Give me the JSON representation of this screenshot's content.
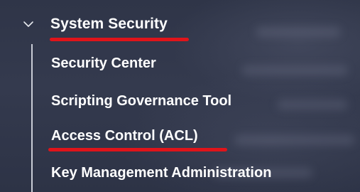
{
  "nav": {
    "group": {
      "label": "System Security",
      "icon": "chevron-down-icon",
      "expanded": true
    },
    "items": [
      {
        "label": "Security Center"
      },
      {
        "label": "Scripting Governance Tool"
      },
      {
        "label": "Access Control (ACL)",
        "highlighted": true
      },
      {
        "label": "Key Management Administration"
      }
    ]
  },
  "colors": {
    "background": "#343a4e",
    "text": "#ffffff",
    "highlight_underline": "#e0141a",
    "tree_line": "#c9ccd6"
  }
}
